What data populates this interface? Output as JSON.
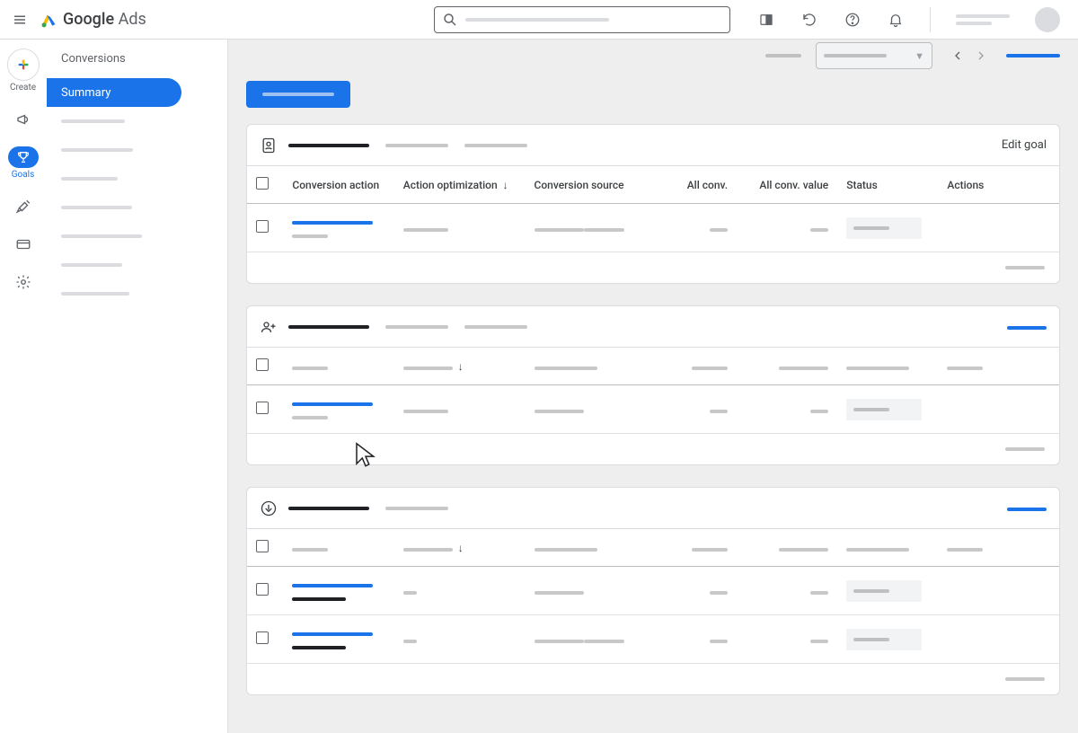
{
  "header": {
    "product_name_bold": "Google",
    "product_name_light": "Ads",
    "search_placeholder": "Search",
    "icons": [
      "chart-icon",
      "refresh-icon",
      "help-icon",
      "bell-icon"
    ]
  },
  "rail": {
    "create_label": "Create",
    "items": [
      {
        "name": "campaigns",
        "icon": "megaphone-icon"
      },
      {
        "name": "goals",
        "icon": "trophy-icon",
        "label": "Goals",
        "active": true
      },
      {
        "name": "tools",
        "icon": "wrench-icon"
      },
      {
        "name": "billing",
        "icon": "card-icon"
      },
      {
        "name": "admin",
        "icon": "gear-icon"
      }
    ]
  },
  "sidebar": {
    "breadcrumb": "Conversions",
    "active_item": "Summary",
    "placeholder_count": 7
  },
  "main": {
    "date_selector_placeholder": " ",
    "title_placeholder": " "
  },
  "cards": [
    {
      "icon": "contact-page-icon",
      "edit_goal": "Edit goal",
      "show_headers_text": true,
      "headers": [
        "Conversion action",
        "Action optimization",
        "Conversion source",
        "All conv.",
        "All conv. value",
        "Status",
        "Actions"
      ],
      "sort_col": 1,
      "rows": [
        {
          "link": true,
          "two_src": true
        }
      ]
    },
    {
      "icon": "group-add-icon",
      "show_headers_text": false,
      "header_tabs": 2,
      "headers_ph_count": 7,
      "sort_col": 1,
      "rows": [
        {
          "link": true
        }
      ]
    },
    {
      "icon": "download-icon",
      "show_headers_text": false,
      "header_tabs": 1,
      "headers_ph_count": 7,
      "sort_col": 1,
      "rows": [
        {
          "link": true,
          "dark_sub": true,
          "short_opt": true
        },
        {
          "link": true,
          "dark_sub": true,
          "short_opt": true,
          "two_src": true
        }
      ]
    }
  ]
}
